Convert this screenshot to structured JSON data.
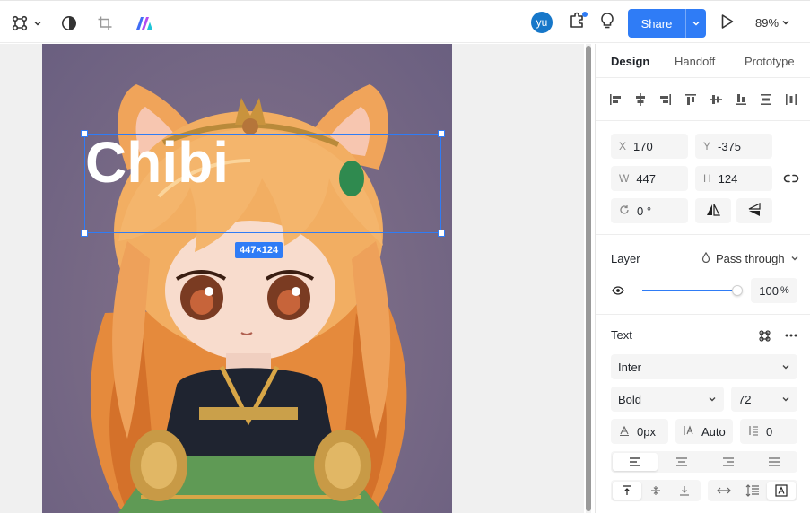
{
  "toolbar": {
    "avatar_initials": "yu",
    "share_label": "Share",
    "zoom_label": "89%"
  },
  "canvas": {
    "text_layer": "Chibi",
    "selection_size": "447×124"
  },
  "panel": {
    "tabs": [
      {
        "label": "Design",
        "active": true
      },
      {
        "label": "Handoff",
        "active": false
      },
      {
        "label": "Prototype",
        "active": false
      }
    ],
    "transform": {
      "x_label": "X",
      "x_value": "170",
      "y_label": "Y",
      "y_value": "-375",
      "w_label": "W",
      "w_value": "447",
      "h_label": "H",
      "h_value": "124",
      "rotation_value": "0 °"
    },
    "layer": {
      "title": "Layer",
      "blend_mode": "Pass through",
      "opacity_value": "100",
      "opacity_unit": "%",
      "opacity_fraction": 1.0
    },
    "text": {
      "title": "Text",
      "font_family": "Inter",
      "font_weight": "Bold",
      "font_size": "72",
      "letter_spacing": "0px",
      "line_height": "Auto",
      "paragraph_spacing": "0"
    }
  },
  "colors": {
    "accent": "#2f7cf6",
    "avatar": "#1677c9"
  }
}
